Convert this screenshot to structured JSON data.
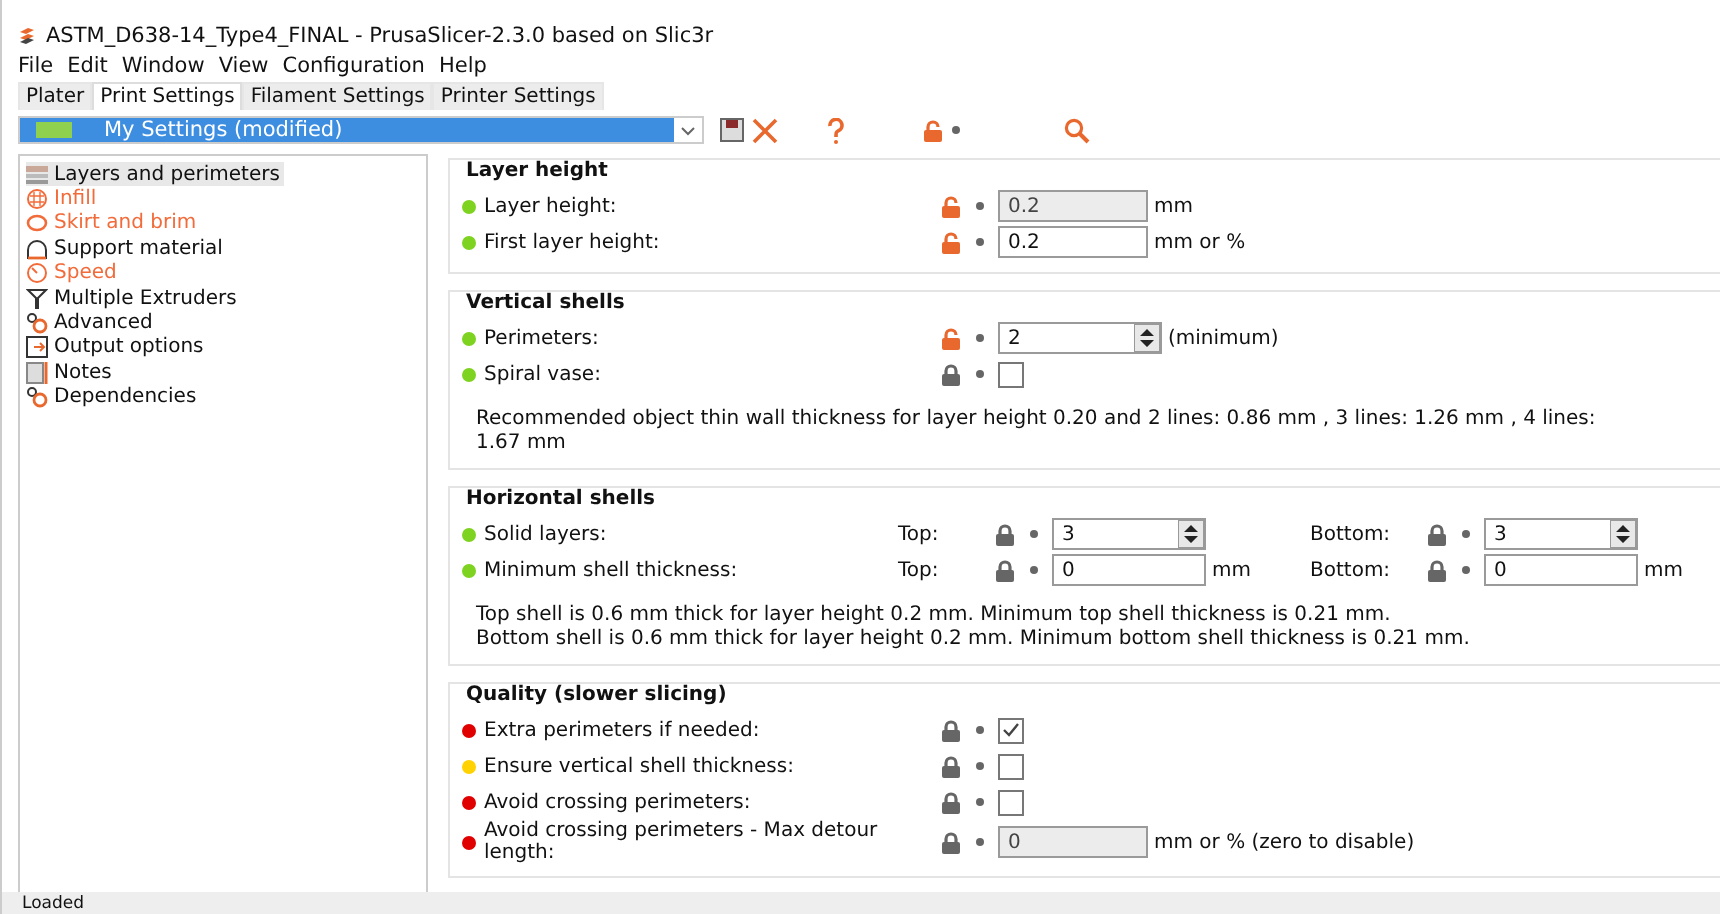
{
  "window": {
    "title": "ASTM_D638-14_Type4_FINAL - PrusaSlicer-2.3.0 based on Slic3r"
  },
  "menu": [
    "File",
    "Edit",
    "Window",
    "View",
    "Configuration",
    "Help"
  ],
  "tabs": [
    {
      "label": "Plater",
      "selected": false
    },
    {
      "label": "Print Settings",
      "selected": true
    },
    {
      "label": "Filament Settings",
      "selected": false
    },
    {
      "label": "Printer Settings",
      "selected": false
    }
  ],
  "preset": {
    "value": "My Settings (modified)"
  },
  "sidebar": {
    "items": [
      {
        "label": "Layers and perimeters",
        "kind": "layers",
        "selected": true,
        "modified": false
      },
      {
        "label": "Infill",
        "kind": "infill",
        "selected": false,
        "modified": true
      },
      {
        "label": "Skirt and brim",
        "kind": "skirt",
        "selected": false,
        "modified": true
      },
      {
        "label": "Support material",
        "kind": "support",
        "selected": false,
        "modified": false
      },
      {
        "label": "Speed",
        "kind": "speed",
        "selected": false,
        "modified": true
      },
      {
        "label": "Multiple Extruders",
        "kind": "funnel",
        "selected": false,
        "modified": false
      },
      {
        "label": "Advanced",
        "kind": "gears",
        "selected": false,
        "modified": false
      },
      {
        "label": "Output options",
        "kind": "output",
        "selected": false,
        "modified": false
      },
      {
        "label": "Notes",
        "kind": "notes",
        "selected": false,
        "modified": false
      },
      {
        "label": "Dependencies",
        "kind": "gears",
        "selected": false,
        "modified": false
      }
    ]
  },
  "sections": [
    {
      "title": "Layer height",
      "rows": [
        {
          "kind": "value",
          "label": "Layer height:",
          "color": "#7ed321",
          "locked": false,
          "value": "0.2",
          "disabled": true,
          "spin": false,
          "unit": "mm"
        },
        {
          "kind": "value",
          "label": "First layer height:",
          "color": "#7ed321",
          "locked": false,
          "value": "0.2",
          "disabled": false,
          "spin": false,
          "unit": "mm or %"
        }
      ]
    },
    {
      "title": "Vertical shells",
      "rows": [
        {
          "kind": "value",
          "label": "Perimeters:",
          "color": "#7ed321",
          "locked": false,
          "value": "2",
          "disabled": false,
          "spin": true,
          "unit": "(minimum)"
        },
        {
          "kind": "check",
          "label": "Spiral vase:",
          "color": "#7ed321",
          "locked": true,
          "checked": false
        }
      ],
      "notes": [
        "Recommended object thin wall thickness for layer height 0.20 and 2 lines: 0.86 mm , 3 lines: 1.26 mm , 4 lines: 1.67 mm"
      ]
    },
    {
      "title": "Horizontal shells",
      "rows": [
        {
          "kind": "pair",
          "label": "Solid layers:",
          "color": "#7ed321",
          "fields": [
            {
              "label": "Top:",
              "locked": true,
              "value": "3",
              "spin": true
            },
            {
              "label": "Bottom:",
              "locked": true,
              "value": "3",
              "spin": true
            }
          ]
        },
        {
          "kind": "pair",
          "label": "Minimum shell thickness:",
          "color": "#7ed321",
          "fields": [
            {
              "label": "Top:",
              "locked": true,
              "value": "0",
              "spin": false,
              "unit": "mm"
            },
            {
              "label": "Bottom:",
              "locked": true,
              "value": "0",
              "spin": false,
              "unit": "mm"
            }
          ]
        }
      ],
      "notes": [
        "Top shell is 0.6 mm thick for layer height 0.2 mm. Minimum top shell thickness is 0.21 mm.",
        "Bottom shell is 0.6 mm thick for layer height 0.2 mm. Minimum bottom shell thickness is 0.21 mm."
      ]
    },
    {
      "title": "Quality (slower slicing)",
      "rows": [
        {
          "kind": "check",
          "label": "Extra perimeters if needed:",
          "color": "#e00000",
          "locked": true,
          "checked": true
        },
        {
          "kind": "check",
          "label": "Ensure vertical shell thickness:",
          "color": "#ffd200",
          "locked": true,
          "checked": false
        },
        {
          "kind": "check",
          "label": "Avoid crossing perimeters:",
          "color": "#e00000",
          "locked": true,
          "checked": false
        },
        {
          "kind": "value",
          "label": "Avoid crossing perimeters - Max detour length:",
          "color": "#e00000",
          "locked": true,
          "value": "0",
          "disabled": true,
          "spin": false,
          "unit": "mm or % (zero to disable)"
        }
      ]
    }
  ],
  "status_bar": {
    "text": "Loaded"
  }
}
